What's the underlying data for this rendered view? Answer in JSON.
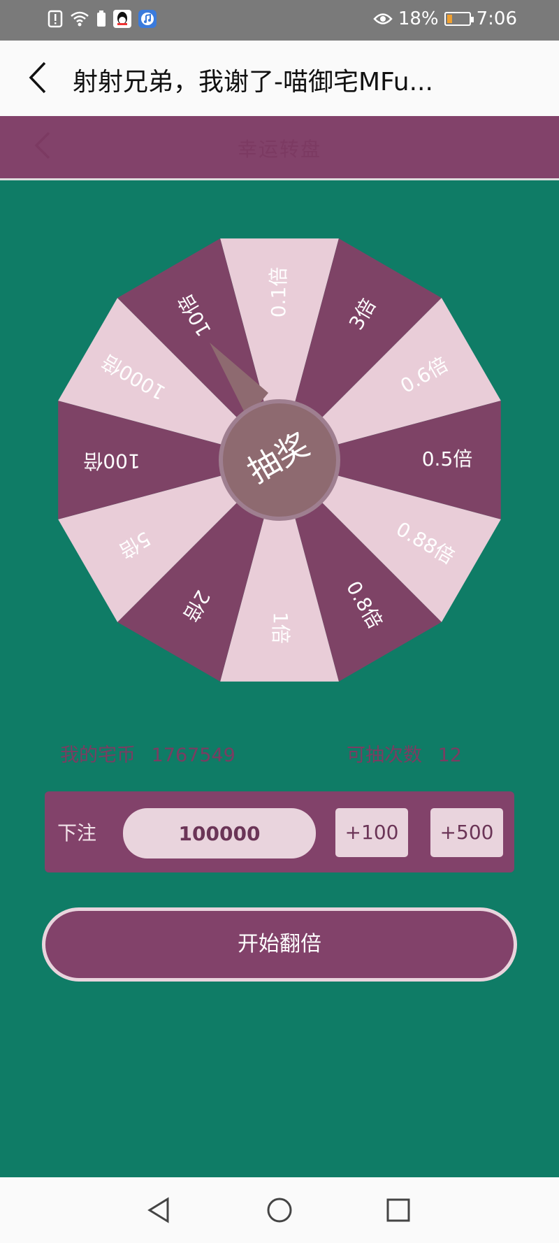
{
  "status_bar": {
    "battery_percent": "18%",
    "time": "7:06",
    "icons": [
      "alert-icon",
      "wifi-icon",
      "battery-small-icon",
      "qq-icon",
      "music-icon",
      "eye-icon",
      "battery-icon"
    ]
  },
  "browser": {
    "title": "射射兄弟，我谢了-喵御宅MFu..."
  },
  "app_header": {
    "title": "幸运转盘"
  },
  "wheel": {
    "center_label": "抽奖",
    "segments": [
      "0.1倍",
      "3倍",
      "0.6倍",
      "0.5倍",
      "0.88倍",
      "0.8倍",
      "1倍",
      "2倍",
      "5倍",
      "100倍",
      "1000倍",
      "10倍"
    ],
    "colors": {
      "light": "#e9cdd8",
      "dark": "#7e4366",
      "hub": "#8e6a70",
      "hub_ring": "#9f7f90"
    }
  },
  "info": {
    "coins_label": "我的宅币",
    "coins_value": "1767549",
    "draws_label": "可抽次数",
    "draws_value": "12"
  },
  "bet": {
    "label": "下注",
    "value": "100000",
    "add100": "+100",
    "add500": "+500"
  },
  "start_button": "开始翻倍",
  "colors": {
    "background": "#0f7c66",
    "primary": "#82426a",
    "light_pink": "#e9d4dd"
  }
}
